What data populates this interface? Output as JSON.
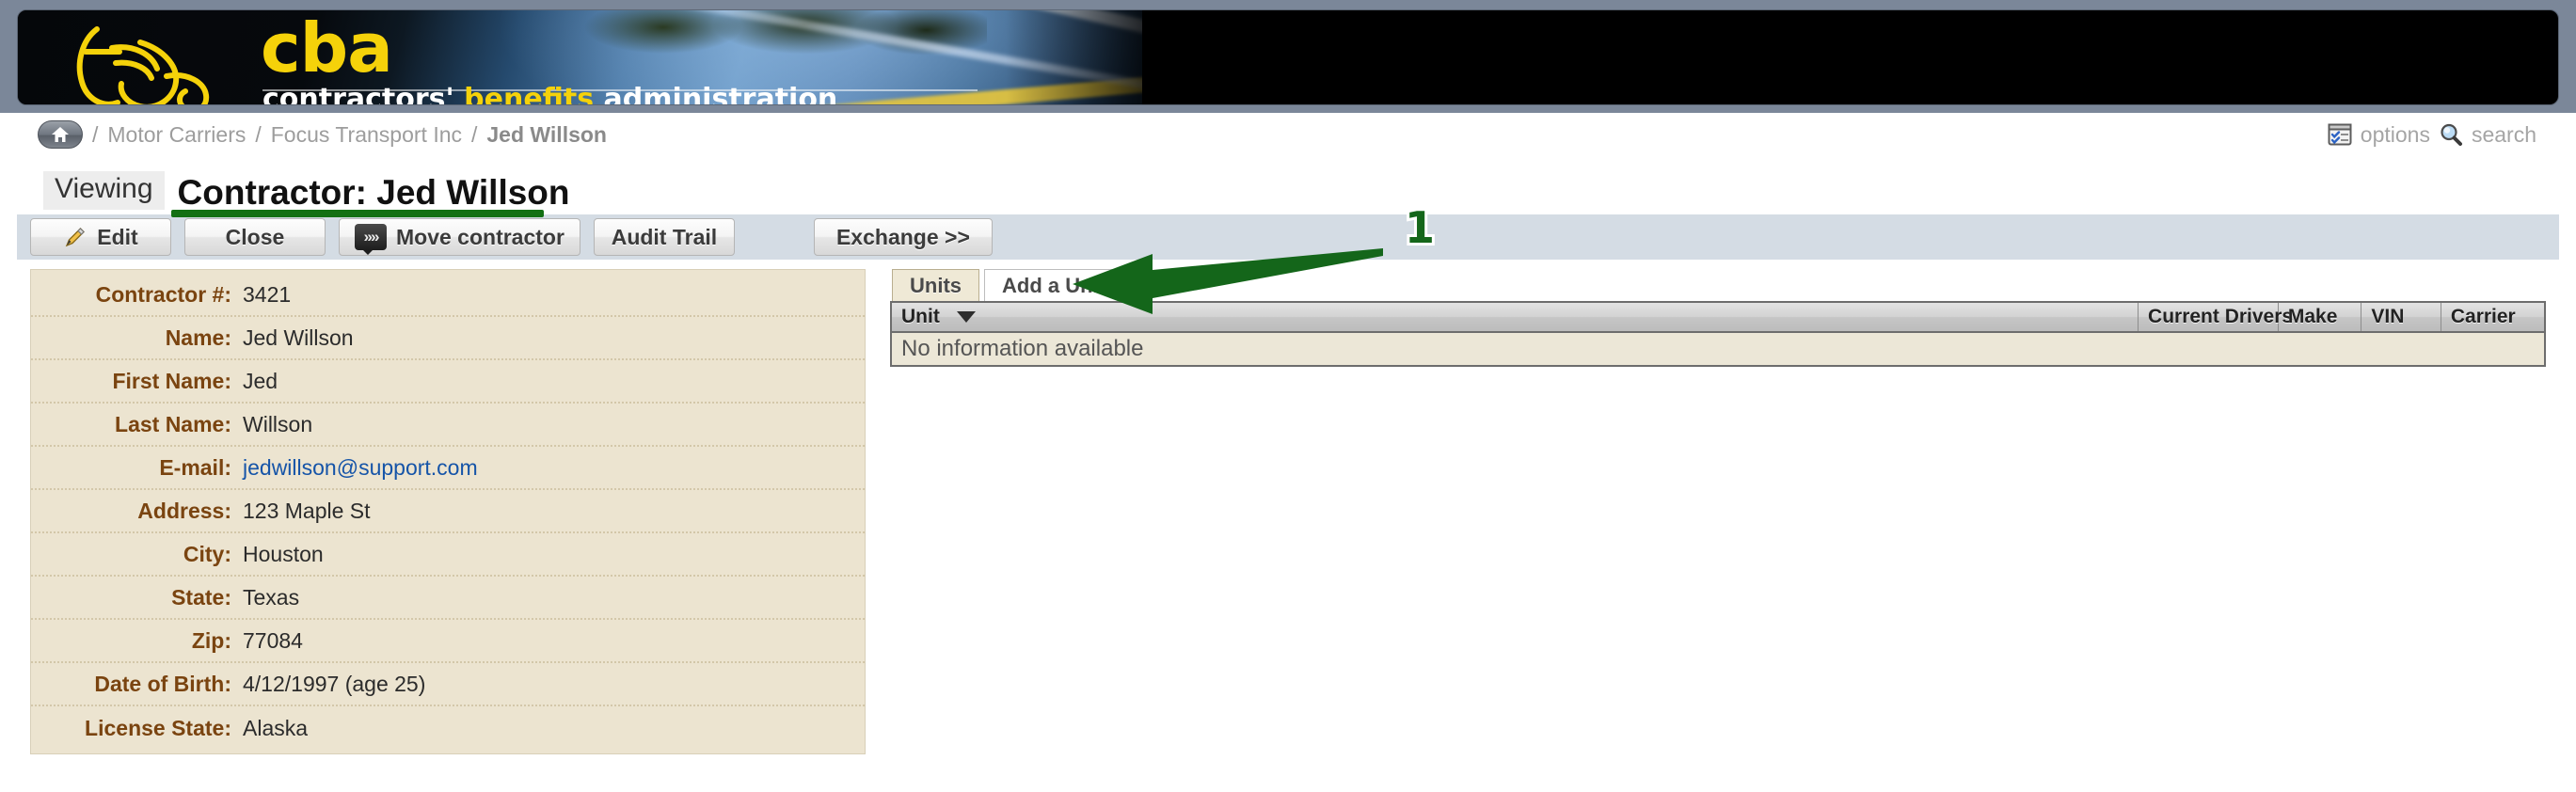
{
  "banner": {
    "logo_text": "cba",
    "tagline_part1": "contractors'",
    "tagline_part2": " benefits",
    "tagline_part3": " administration"
  },
  "breadcrumb": {
    "home_icon": "home-icon",
    "sep": "/",
    "items": [
      {
        "label": "Motor Carriers",
        "current": false
      },
      {
        "label": "Focus Transport Inc",
        "current": false
      },
      {
        "label": "Jed Willson",
        "current": true
      }
    ]
  },
  "header_tools": {
    "options_label": "options",
    "options_icon": "options-window-icon",
    "search_label": "search",
    "search_icon": "magnifier-icon"
  },
  "title": {
    "mode_chip": "Viewing",
    "heading": "Contractor: Jed Willson",
    "underline_color": "#137013"
  },
  "toolbar": {
    "edit_label": "Edit",
    "edit_icon": "pencil-icon",
    "close_label": "Close",
    "move_label": "Move contractor",
    "move_icon": "chevrons-right-icon",
    "audit_label": "Audit Trail",
    "exchange_label": "Exchange >>"
  },
  "detail": {
    "rows": [
      {
        "label": "Contractor #:",
        "value": "3421",
        "link": false
      },
      {
        "label": "Name:",
        "value": "Jed Willson",
        "link": false
      },
      {
        "label": "First Name:",
        "value": "Jed",
        "link": false
      },
      {
        "label": "Last Name:",
        "value": "Willson",
        "link": false
      },
      {
        "label": "E-mail:",
        "value": "jedwillson@support.com",
        "link": true
      },
      {
        "label": "Address:",
        "value": "123 Maple St",
        "link": false
      },
      {
        "label": "City:",
        "value": "Houston",
        "link": false
      },
      {
        "label": "State:",
        "value": "Texas",
        "link": false
      },
      {
        "label": "Zip:",
        "value": "77084",
        "link": false
      },
      {
        "label": "Date of Birth:",
        "value": "4/12/1997 (age 25)",
        "link": false
      },
      {
        "label": "License State:",
        "value": "Alaska",
        "link": false
      }
    ]
  },
  "units": {
    "tabs": [
      {
        "label": "Units",
        "active": true
      },
      {
        "label": "Add a Unit",
        "active": false
      }
    ],
    "columns": [
      "Unit",
      "Current Drivers",
      "Make",
      "VIN",
      "Carrier"
    ],
    "sort_column": "Unit",
    "sort_direction": "descending",
    "empty_message": "No information available",
    "rows": []
  },
  "annotation": {
    "number": "1",
    "color": "#14661a",
    "points_to": "Add a Unit"
  }
}
